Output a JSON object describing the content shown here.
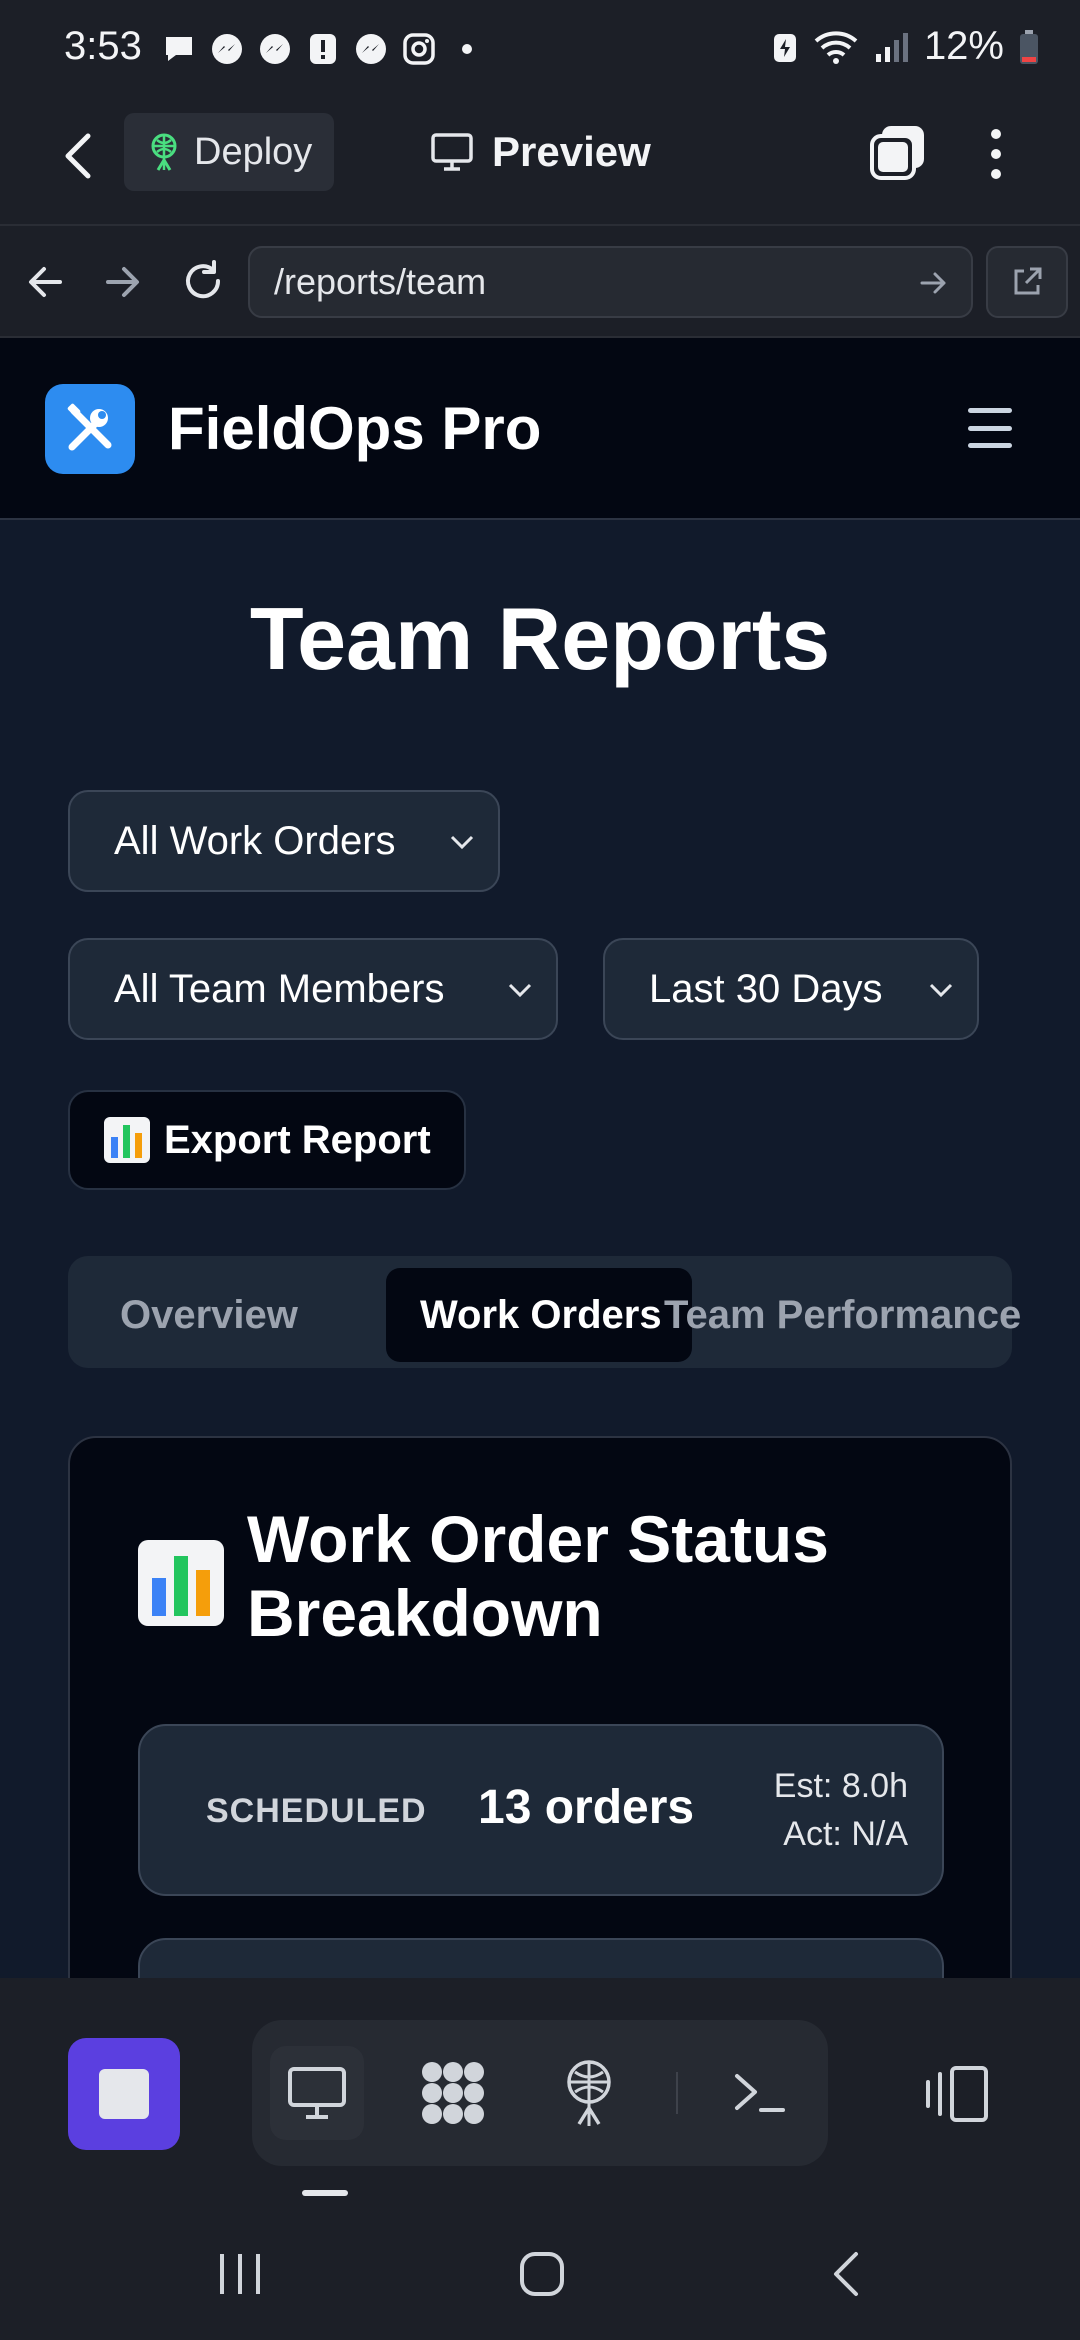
{
  "status_bar": {
    "time": "3:53",
    "battery": "12%",
    "notification_icons": [
      "chat-bubble-icon",
      "messenger-icon",
      "messenger-icon",
      "alert-icon",
      "messenger-icon",
      "instagram-icon",
      "dot-icon"
    ]
  },
  "app_bar": {
    "deploy_label": "Deploy",
    "preview_label": "Preview"
  },
  "url_bar": {
    "url": "/reports/team"
  },
  "site": {
    "brand": "FieldOps Pro",
    "accent_color": "#2d8cf0",
    "page_title": "Team Reports",
    "filters": {
      "work_orders": "All Work Orders",
      "team_members": "All Team Members",
      "date_range": "Last 30 Days"
    },
    "export_label": "Export Report",
    "tabs": [
      {
        "label": "Overview",
        "active": false
      },
      {
        "label": "Work Orders",
        "active": true
      },
      {
        "label": "Team Performance",
        "active": false
      }
    ],
    "card": {
      "title": "Work Order Status Breakdown",
      "rows": [
        {
          "status": "SCHEDULED",
          "count": "13 orders",
          "est": "Est: 8.0h",
          "act": "Act: N/A"
        }
      ]
    }
  },
  "dock": {
    "items": [
      "monitor-icon",
      "apps-grid-icon",
      "deploy-antenna-icon",
      "terminal-icon"
    ],
    "stop_color": "#5b3fe0"
  }
}
